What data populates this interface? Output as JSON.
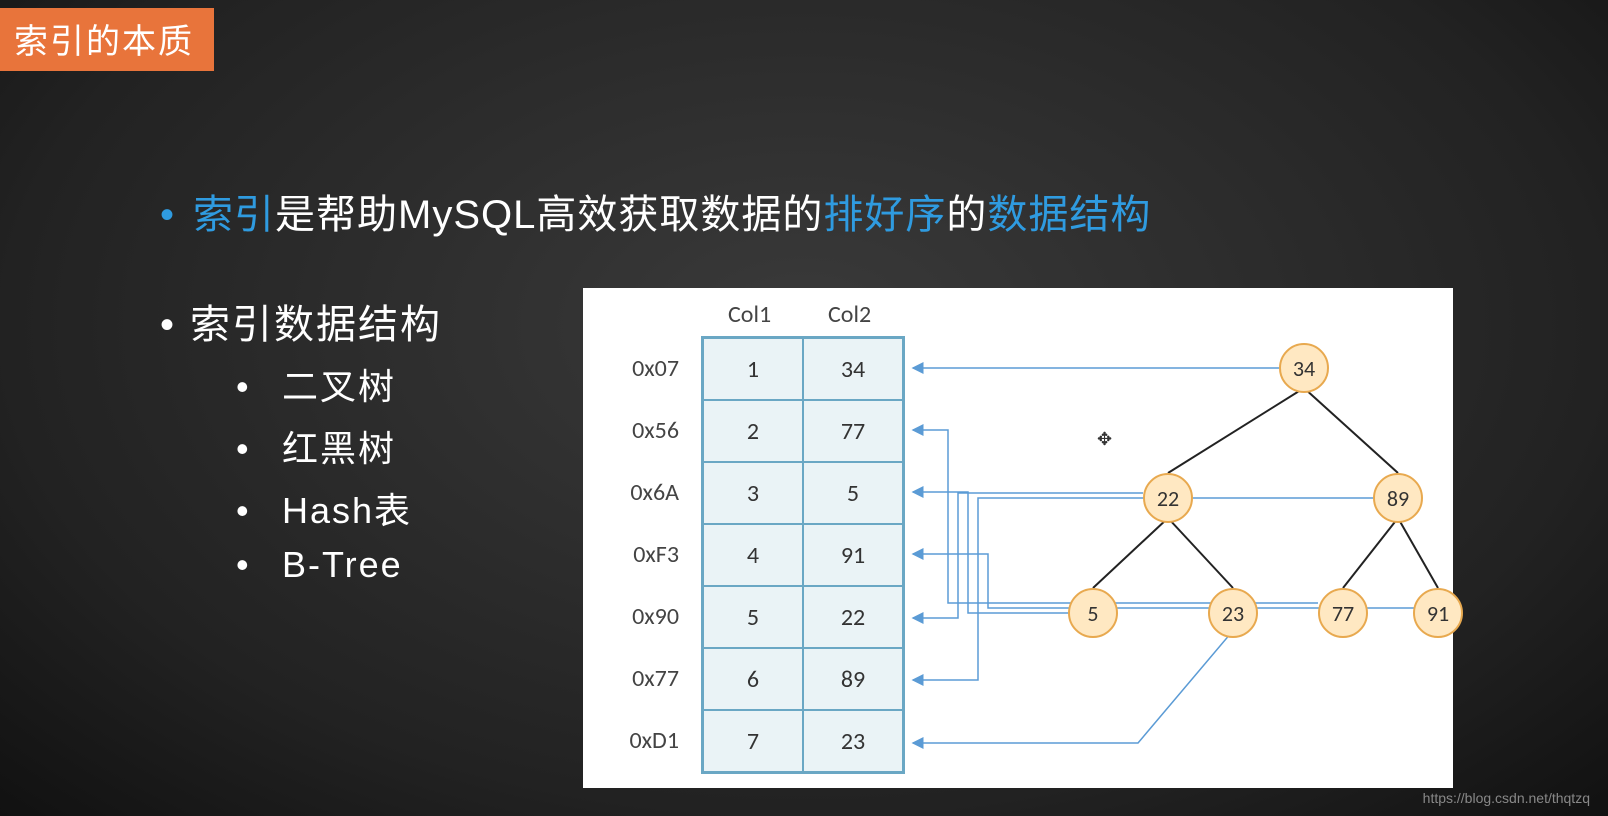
{
  "title_badge": "索引的本质",
  "main_line": {
    "p1": "索引",
    "p2": "是帮助MySQL高效获取数据的",
    "p3": "排好序",
    "p4": "的",
    "p5": "数据结构"
  },
  "sub_heading": "索引数据结构",
  "sub_items": [
    "二叉树",
    "红黑树",
    "Hash表",
    "B-Tree"
  ],
  "diagram": {
    "col1_label": "Col1",
    "col2_label": "Col2",
    "rows": [
      {
        "addr": "0x07",
        "c1": "1",
        "c2": "34"
      },
      {
        "addr": "0x56",
        "c1": "2",
        "c2": "77"
      },
      {
        "addr": "0x6A",
        "c1": "3",
        "c2": "5"
      },
      {
        "addr": "0xF3",
        "c1": "4",
        "c2": "91"
      },
      {
        "addr": "0x90",
        "c1": "5",
        "c2": "22"
      },
      {
        "addr": "0x77",
        "c1": "6",
        "c2": "89"
      },
      {
        "addr": "0xD1",
        "c1": "7",
        "c2": "23"
      }
    ],
    "tree_nodes": {
      "root": "34",
      "l": "22",
      "r": "89",
      "ll": "5",
      "lr": "23",
      "rl": "77",
      "rr": "91"
    }
  },
  "watermark": "https://blog.csdn.net/thqtzq"
}
